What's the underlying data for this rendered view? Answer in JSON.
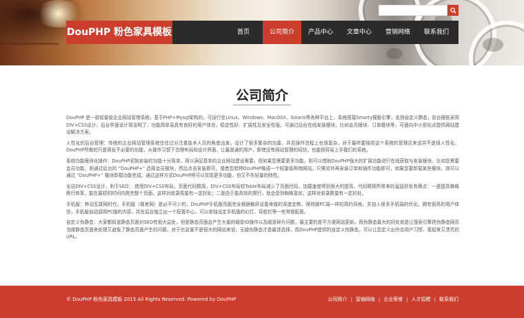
{
  "brand": {
    "title": "DouPHP 粉色家具模板"
  },
  "search": {
    "placeholder": ""
  },
  "nav": {
    "items": [
      {
        "label": "首页"
      },
      {
        "label": "公司简介",
        "active": true
      },
      {
        "label": "产品中心"
      },
      {
        "label": "文章中心"
      },
      {
        "label": "营销网络"
      },
      {
        "label": "联系我们"
      }
    ]
  },
  "page": {
    "title": "公司简介",
    "paragraphs": [
      "DouPHP 是一款轻量级企业网站管理系统，基于PHP+Mysql架构的，可运行在Linux、Windows、MacOSX、Solaris等各种平台上，系统搭载Smarty模板引擎，支持自定义静态，前台模板采用DIV+CSS设计，后台界面设计简洁明了，功能简单易具有良好的用户体验，稳定性好、扩展性及安全性强，可通过后台在线安装模块，比如会员模块、订单模块等，可面向中小型站点提供网站建设解决方案。",
      "人性化的后台管理：传统的企业网站管理系统往往过分注重技术人员的角度出发，设计了很多繁杂的功能，并且操作流程上也很复杂，对于最终要操控这个系统的管理员来说并不是很人性化，DouPHP所做的只是简化不必要的功能，从操作习惯下合理布局和设计界面，让最普通的用户，即使没有网站管理的经验，也能很容易上手我们的系统。",
      "系统功能模块化操作：DouPHP初始安装的功能十分简单，用以满足基本的企业网站建设需要。但如果您需要更多功能，则可以借助DouPHP强大的扩展功能进行在线获取与安装模块，比如您需要会员功能，则通过后台的 “DouPHP+” 选择会员模块，然后点击安装即可。或者您想将DouPHP做成一个轻量级购物网站，只需另外再安装订单和插件功能即可，如果您要卸载某些模块，则可以通过 “DouPHP+” 模块卸载功能完成。通过这样方式DouPHP将可以实现更多功能，但又不失轻量的特性。",
      "全站DIV+CSS设计，利于SEO： 使用DIV+CSS布局，页面代码精简，DIV+CSS布局较Table布局减少了页面代码，加载速度得到很大的提高，代码精简所带来的直接好处有两点：一是提高蜘蛛爬行效率，能在最短的时间内爬完整个页面，这样对收录质量有一定好处；二是由于能高效的爬行，就会受到蜘蛛喜欢，这样对收录数量有一定好处。",
      "手机版：移动互联网时代，手机版（微官网）是必不可少的，DouPHP手机版页面完全根据触屏设备来做的深度定制，保持跟PC端一样的简约风格，并加入很多手机端的优化，拥有很高的用户体验，手机版自动调用PC版的内容，并在后台独立出一个配置中心，可以单独设定手机版的幻灯、导航栏等一些常规配置。",
      "自定义伪静态：大家都知道静态页面对SEO有很大益处，但是静态页面会产生大量的磁盘IO操作以及磁盘碎片问题，最主要的是不方便网站更新。而伪静态最大的好处就是让搜索引擎把伪静态网页当做静态页面来处理又避免了静态页面产生的问题，对于信息量不是很大的网站来说，无疑伪静态才是最佳选择，而DouPHP提供的自定义伪静态，可以让您定义出符合用户习惯、看起来又漂亮的URL。"
    ]
  },
  "footer": {
    "copyright": "© DouPHP 粉色家具模板 2015 All Rights Reserved. Powered by DouPHP",
    "links": [
      {
        "label": "公司简介"
      },
      {
        "label": "营销网络"
      },
      {
        "label": "企业荣誉"
      },
      {
        "label": "人才招聘"
      },
      {
        "label": "联系我们"
      }
    ]
  },
  "colors": {
    "accent": "#cc3d2e",
    "nav_bg": "#2b2b2b",
    "text": "#555555"
  },
  "icons": {
    "search": "search-icon"
  }
}
